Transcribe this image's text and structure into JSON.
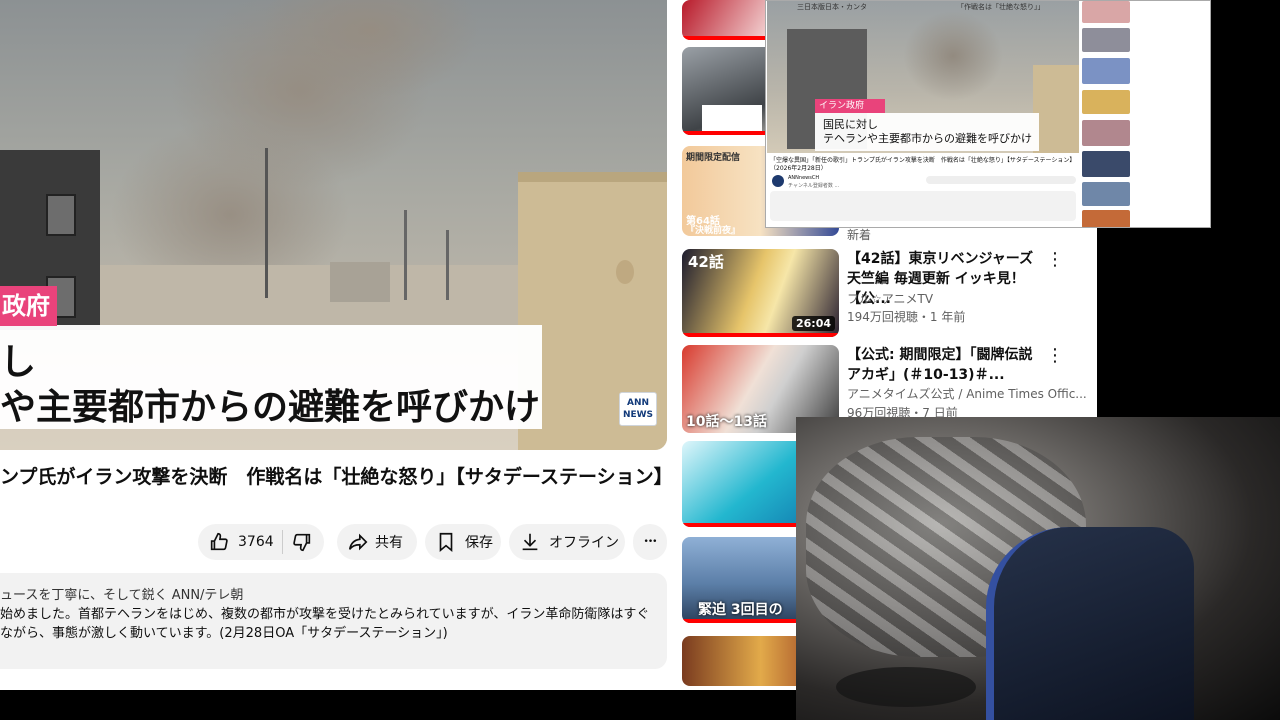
{
  "player": {
    "caption_tag": "政府",
    "caption_line1": "し",
    "caption_line2": "や主要都市からの避難を呼びかけ",
    "logo_line1": "ANN",
    "logo_line2": "NEWS"
  },
  "video": {
    "title": "ンプ氏がイラン攻撃を決断　作戦名は「壮絶な怒り」【サタデーステーション】"
  },
  "actions": {
    "like_count": "3764",
    "share_label": "共有",
    "save_label": "保存",
    "offline_label": "オフライン",
    "more_glyph": "•••"
  },
  "description": {
    "line1": "ュースを丁寧に、そして鋭く ANN/テレ朝",
    "line2": "始めました。首都テヘランをはじめ、複数の都市が攻撃を受けたとみられていますが、イラン革命防衛隊はすぐ",
    "line3": "ながら、事態が激しく動いています。(2月28日OA「サタデーステーション」)"
  },
  "sidebar": {
    "new_label": "新着",
    "items": [
      {
        "title": "【42話】東京リベンジャーズ 天竺編 毎週更新 イッキ見！【公...",
        "channel": "フル☆アニメTV",
        "stats": "194万回視聴・1 年前",
        "duration": "26:04",
        "thumb_text": "42話"
      },
      {
        "title": "【公式: 期間限定】「闘牌伝説アカギ」(＃10-13)＃...",
        "channel": "アニメタイムズ公式 / Anime Times Offic...",
        "stats": "96万回視聴・7 日前",
        "thumb_text": "10話〜13話"
      }
    ],
    "thumb_labels": {
      "t2": "第64話",
      "t2b": "『決戦前夜』",
      "t2c": "期間限定配信",
      "t6": "緊迫 3回目の"
    }
  },
  "mini": {
    "top_left": "三日本版日本・カンタ",
    "top_right": "「作戦名は「壮絶な怒り」」",
    "tag": "イラン政府",
    "line1": "国民に対し",
    "line2": "テヘランや主要都市からの避難を呼びかけ",
    "title": "「空爆な異国」「新任の歌引」トランプ氏がイラン攻撃を決断　作戦名は「壮絶な怒り」【サタデーステーション】（2026年2月28日）",
    "channel": "ANNnewsCH",
    "subs": "チャンネル登録者数 ..."
  },
  "colors": {
    "accent": "#e9437b",
    "progress": "#ff0000"
  }
}
